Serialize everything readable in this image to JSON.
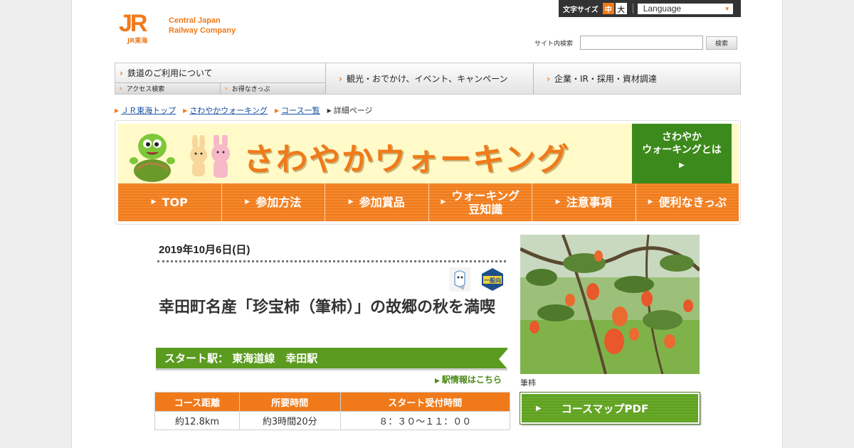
{
  "header": {
    "logo_mark": "JR",
    "logo_sub": "JR東海",
    "logo_line1": "Central Japan",
    "logo_line2": "Railway Company",
    "fontsize_label": "文字サイズ",
    "fontsize_mid": "中",
    "fontsize_big": "大",
    "language": "Language",
    "search_label": "サイト内検索",
    "search_value": "",
    "search_button": "検索"
  },
  "gnav": {
    "rail": "鉄道のご利用について",
    "access": "アクセス検索",
    "tickets": "お得なきっぷ",
    "sightseeing": "観光・おでかけ、イベント、キャンペーン",
    "corporate": "企業・IR・採用・資材調達"
  },
  "breadcrumb": {
    "top": "ＪＲ東海トップ",
    "walking": "さわやかウォーキング",
    "courses": "コース一覧",
    "current": "詳細ページ"
  },
  "banner": {
    "title": "さわやかウォーキング",
    "about_line1": "さわやか",
    "about_line2": "ウォーキングとは",
    "nav": {
      "top": "TOP",
      "how": "参加方法",
      "prizes": "参加賞品",
      "tips_line1": "ウォーキング",
      "tips_line2": "豆知識",
      "caution": "注意事項",
      "tickets": "便利なきっぷ"
    }
  },
  "event": {
    "date": "2019年10月6日(日)",
    "badge": "一般向",
    "title": "幸田町名産「珍宝柿（筆柿）」の故郷の秋を満喫",
    "start": "スタート駅：  東海道線　幸田駅",
    "station_info": "駅情報はこちら",
    "table": {
      "headers": [
        "コース距離",
        "所要時間",
        "スタート受付時間"
      ],
      "values": [
        "約12.8km",
        "約3時間20分",
        "８：３０～１１：００"
      ]
    },
    "photo_caption": "筆柿",
    "map_button": "コースマップPDF"
  },
  "colors": {
    "accent_orange": "#f07a1a",
    "accent_green": "#5b9b1f",
    "banner_yellow": "#fffac8"
  }
}
